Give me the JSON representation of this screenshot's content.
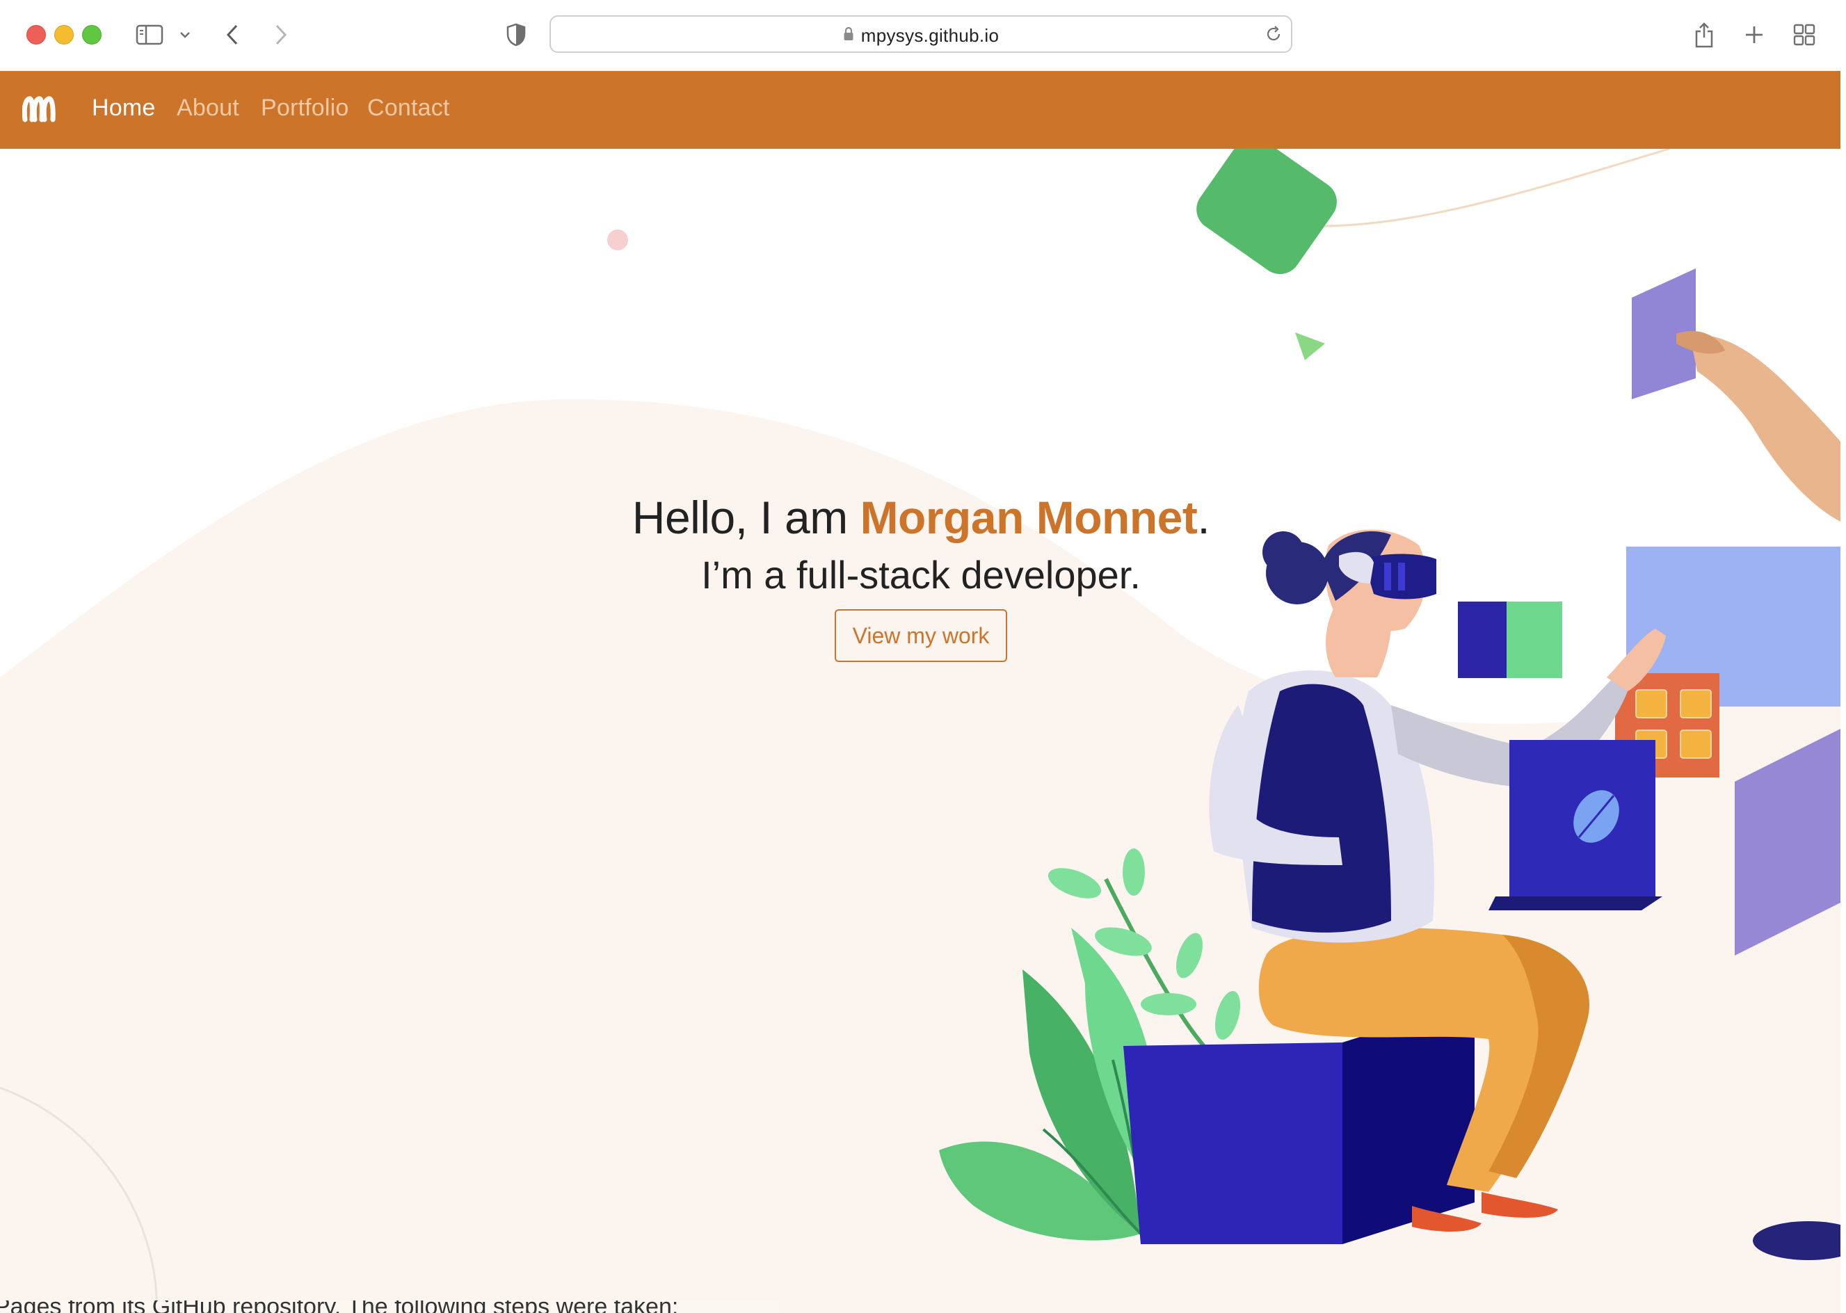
{
  "browser": {
    "url": "mpysys.github.io"
  },
  "nav": {
    "brand_icon": "m-logo-icon",
    "links": [
      {
        "label": "Home",
        "active": true
      },
      {
        "label": "About",
        "active": false
      },
      {
        "label": "Portfolio",
        "active": false
      },
      {
        "label": "Contact",
        "active": false
      }
    ]
  },
  "hero": {
    "greeting_prefix": "Hello, I am ",
    "name": "Morgan Monnet",
    "greeting_suffix": ".",
    "tagline": "I’m a full-stack developer.",
    "cta_label": "View my work"
  },
  "bottom_peek_text": "Pages from its GitHub repository. The following steps were taken:",
  "colors": {
    "brand": "#cd742b",
    "hero_bg": "#fcf5ef",
    "text": "#222222"
  }
}
